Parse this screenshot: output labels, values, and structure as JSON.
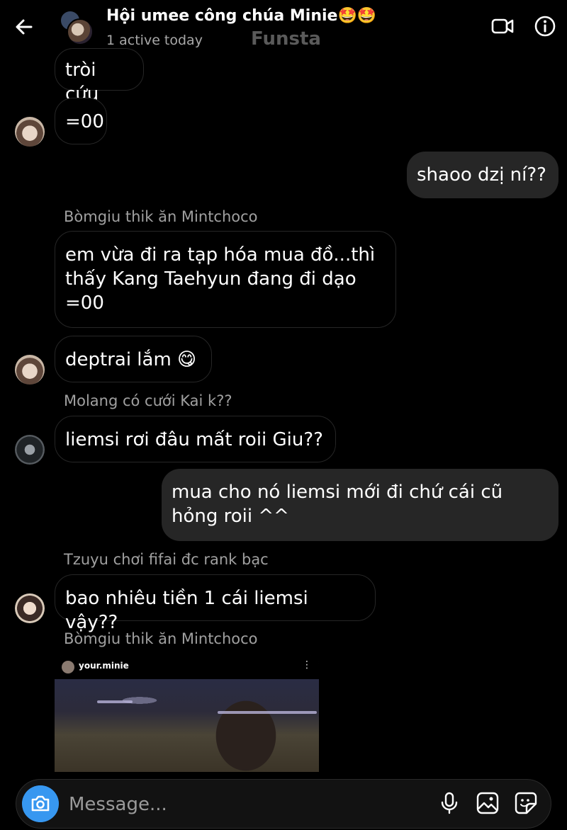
{
  "header": {
    "title": "Hội umee công chúa Minie🤩🤩",
    "status": "1 active today",
    "watermark": "Funsta",
    "icons": [
      "back-arrow-icon",
      "video-call-icon",
      "info-icon"
    ]
  },
  "messages": [
    {
      "type": "incoming",
      "text": "tròi cứu"
    },
    {
      "type": "incoming",
      "text": "=00"
    },
    {
      "type": "outgoing",
      "text": "shaoo dzị ní??"
    },
    {
      "type": "sender",
      "text": "Bòmgiu thik ăn Mintchoco"
    },
    {
      "type": "incoming",
      "text": "em vừa đi ra tạp hóa mua đồ...thì\nthấy Kang Taehyun đang đi dạo\n=00"
    },
    {
      "type": "incoming",
      "text": "deptrai lắm 😋"
    },
    {
      "type": "sender",
      "text": "Molang có cưới Kai k??"
    },
    {
      "type": "incoming",
      "text": "liemsi rơi đâu mất roii Giu??"
    },
    {
      "type": "outgoing",
      "text": "mua cho nó liemsi mới đi chứ cái cũ\nhỏng roii ^^"
    },
    {
      "type": "sender",
      "text": "Tzuyu chơi fifai đc rank bạc"
    },
    {
      "type": "incoming",
      "text": "bao nhiêu tiền 1 cái liemsi vậy??"
    },
    {
      "type": "sender",
      "text": "Bòmgiu thik ăn Mintchoco"
    }
  ],
  "shared_post": {
    "username": "your.minie",
    "more": "⋮"
  },
  "composer": {
    "placeholder": "Message...",
    "icons": [
      "camera-icon",
      "microphone-icon",
      "gallery-icon",
      "sticker-icon"
    ],
    "camera_color": "#3797f0"
  }
}
